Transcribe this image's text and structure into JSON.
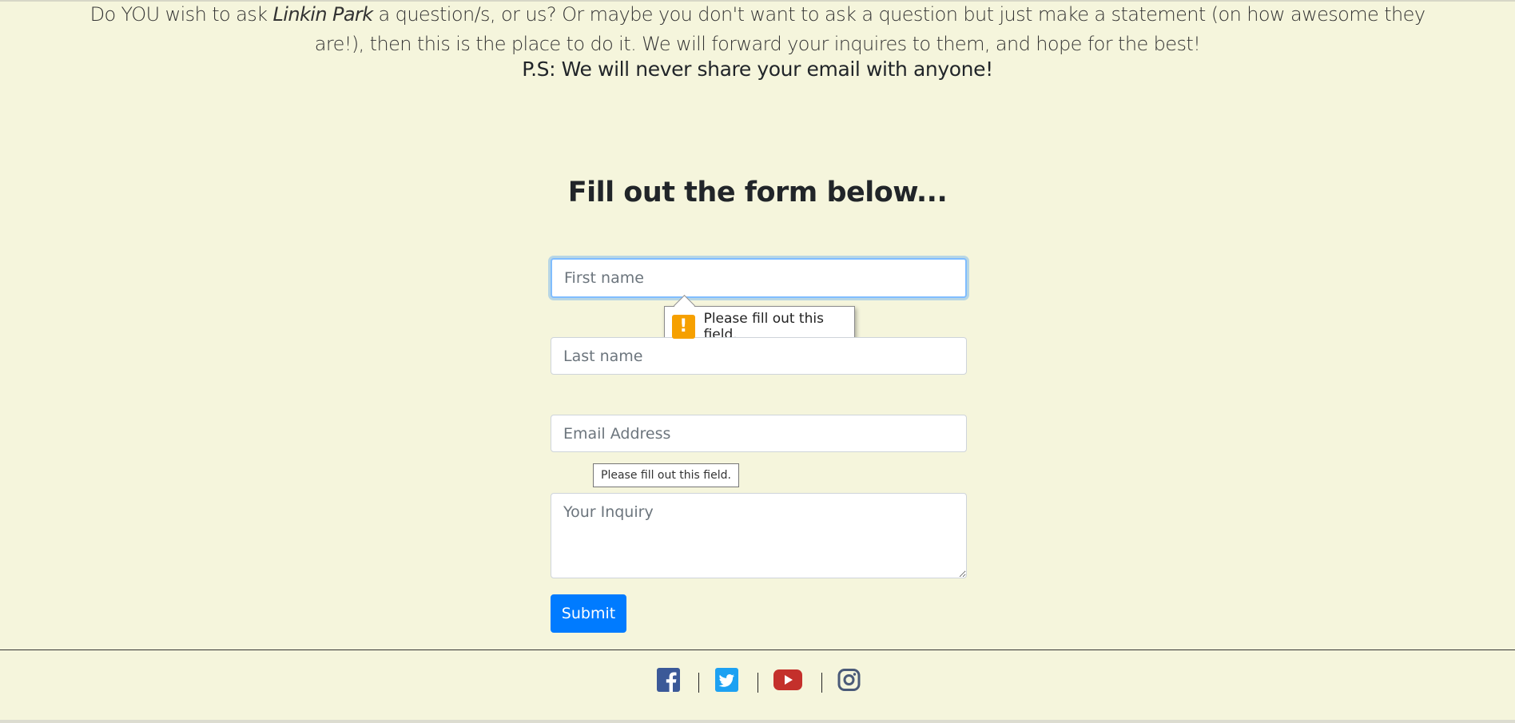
{
  "intro": {
    "text_before": "Do YOU wish to ask ",
    "band_name": "Linkin Park",
    "text_after": " a question/s, or us? Or maybe you don't want to ask a question but just make a statement (on how awesome they are!), then this is the place to do it. We will forward your inquires to them, and hope for the best!",
    "ps": "P.S: We will never share your email with anyone!"
  },
  "form": {
    "title": "Fill out the form below...",
    "first_name_placeholder": "First name",
    "last_name_placeholder": "Last name",
    "email_placeholder": "Email Address",
    "inquiry_placeholder": "Your Inquiry",
    "submit_label": "Submit"
  },
  "validation": {
    "bubble_icon": "!",
    "bubble_message": "Please fill out this field.",
    "tooltip_message": "Please fill out this field."
  },
  "footer": {
    "social_icons": [
      "facebook-icon",
      "twitter-icon",
      "youtube-icon",
      "instagram-icon"
    ]
  },
  "colors": {
    "background": "#f5f5dc",
    "primary": "#007bff",
    "warning": "#f6a000",
    "facebook": "#3b5998",
    "twitter": "#1da1f2",
    "youtube": "#c4302b",
    "instagram": "#4a5a78"
  }
}
